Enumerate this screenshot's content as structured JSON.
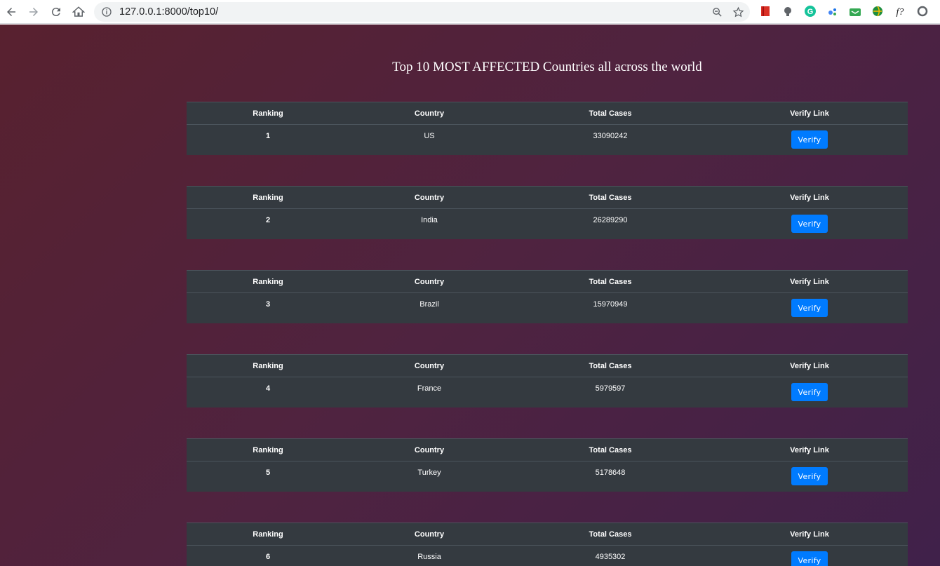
{
  "browser": {
    "url": "127.0.0.1:8000/top10/",
    "url_host": "127.0.0.1",
    "url_rest": ":8000/top10/"
  },
  "page": {
    "title": "Top 10 MOST AFFECTED Countries all across the world",
    "columns": {
      "ranking": "Ranking",
      "country": "Country",
      "total_cases": "Total Cases",
      "verify_link": "Verify Link"
    },
    "verify_label": "Verify",
    "rows": [
      {
        "rank": "1",
        "country": "US",
        "cases": "33090242"
      },
      {
        "rank": "2",
        "country": "India",
        "cases": "26289290"
      },
      {
        "rank": "3",
        "country": "Brazil",
        "cases": "15970949"
      },
      {
        "rank": "4",
        "country": "France",
        "cases": "5979597"
      },
      {
        "rank": "5",
        "country": "Turkey",
        "cases": "5178648"
      },
      {
        "rank": "6",
        "country": "Russia",
        "cases": "4935302"
      }
    ]
  },
  "colors": {
    "table_bg": "#343a40",
    "button": "#007bff",
    "gradient_start": "#58212f",
    "gradient_end": "#40214a"
  }
}
